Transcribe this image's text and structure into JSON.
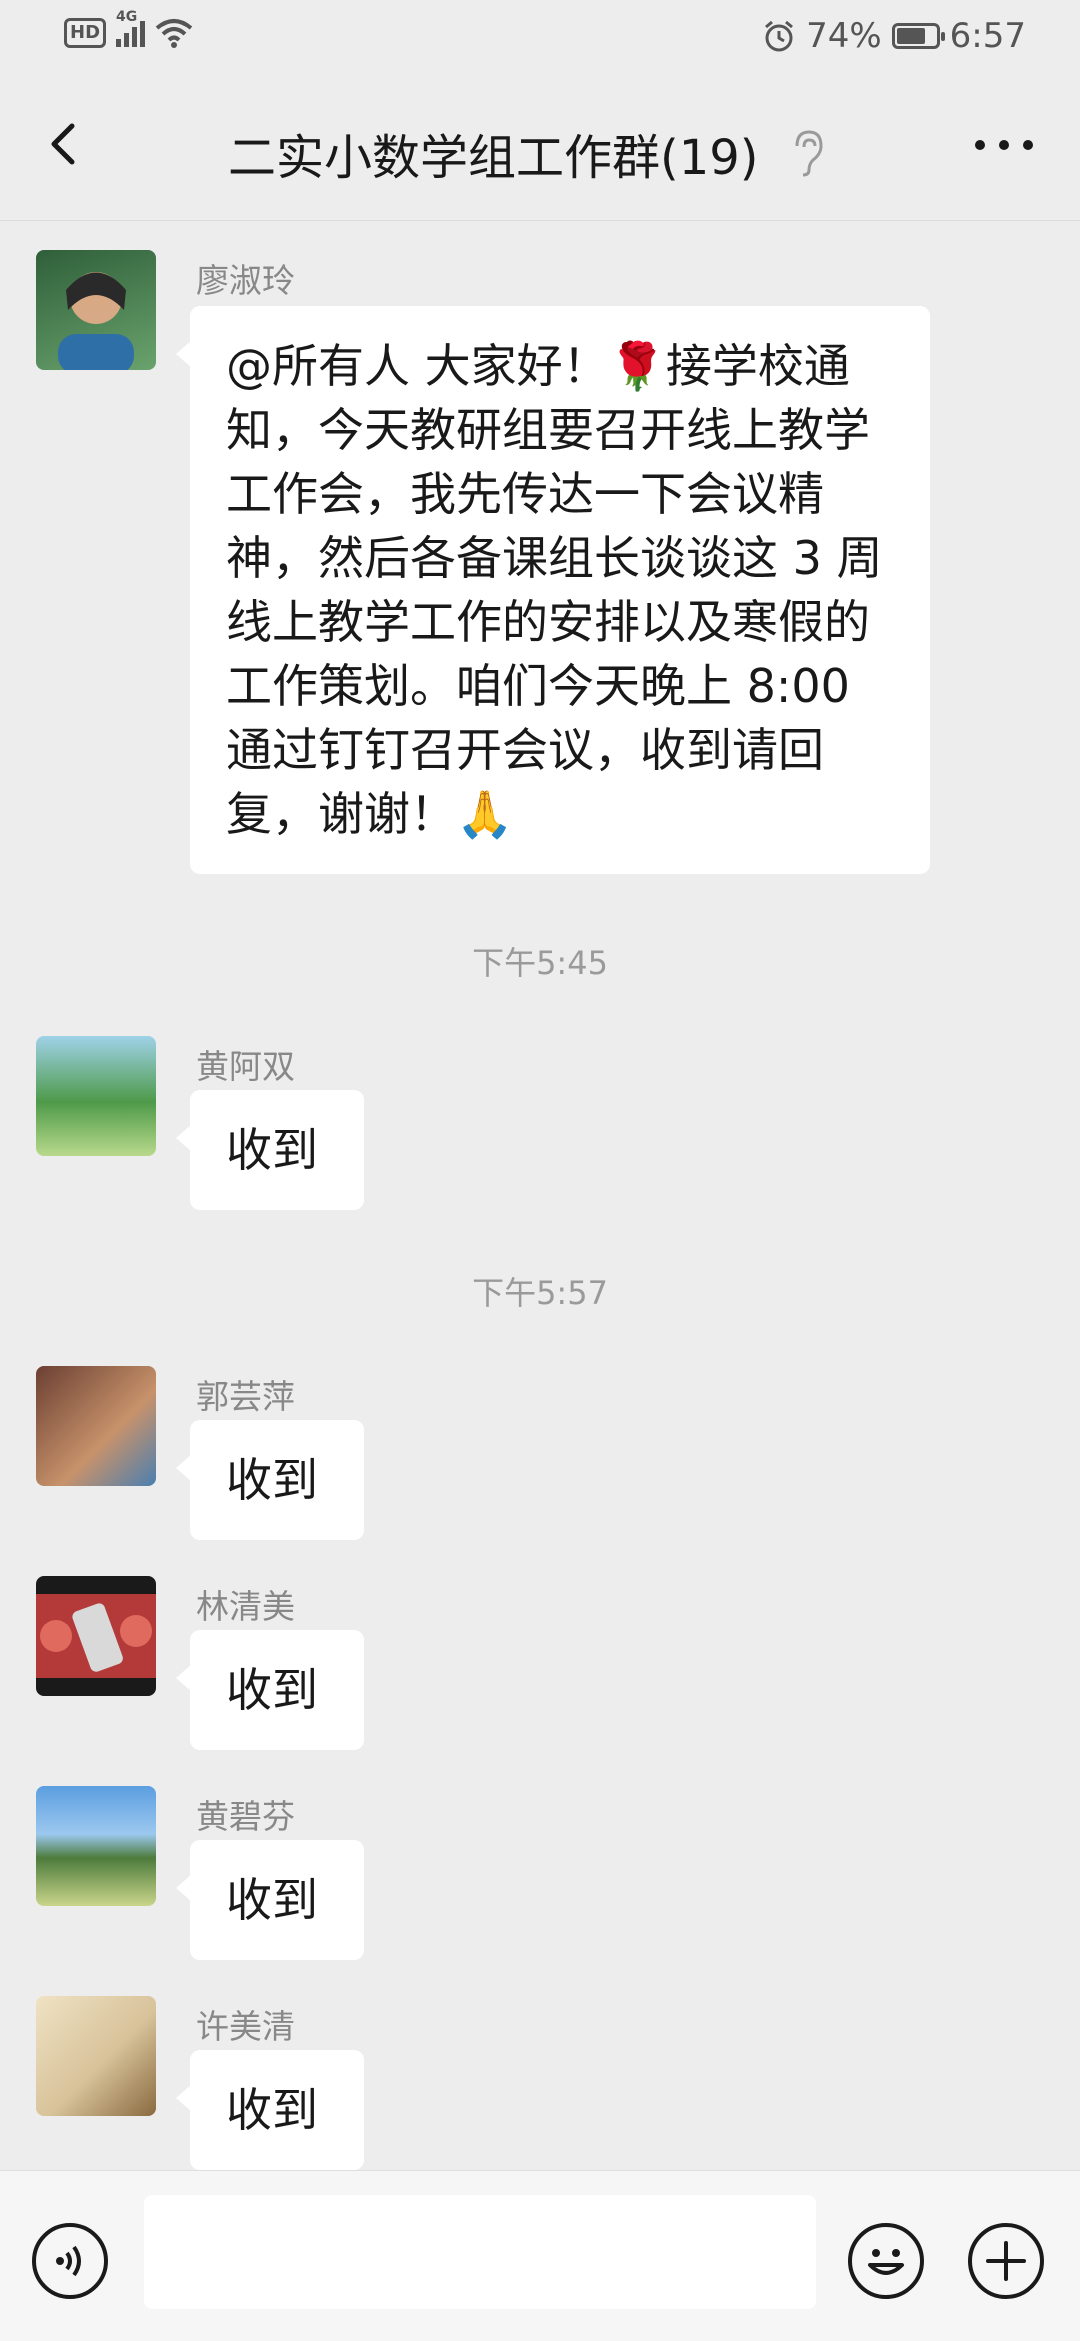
{
  "status_bar": {
    "network": "4G",
    "hd": "HD",
    "battery_text": "74%",
    "battery_level": 0.74,
    "time": "6:57"
  },
  "header": {
    "title": "二实小数学组工作群(19)",
    "back_icon": "chevron-left-icon",
    "mute_icon": "ear-icon",
    "more_icon": "more-icon"
  },
  "messages": [
    {
      "sender": "廖淑玲",
      "text": "@所有人 大家好！🌹接学校通知，今天教研组要召开线上教学工作会，我先传达一下会议精神，然后各备课组长谈谈这 3 周线上教学工作的安排以及寒假的工作策划。咱们今天晚上 8:00 通过钉钉召开会议，收到请回复，谢谢！🙏",
      "avatar_colors": [
        "#2f5f3a",
        "#6aa36d"
      ]
    },
    {
      "time": "下午5:45"
    },
    {
      "sender": "黄阿双",
      "text": "收到",
      "avatar_colors": [
        "#3e8f3e",
        "#b9d98b"
      ]
    },
    {
      "time": "下午5:57"
    },
    {
      "sender": "郭芸萍",
      "text": "收到",
      "avatar_colors": [
        "#6b3f32",
        "#c7926b"
      ]
    },
    {
      "sender": "林清美",
      "text": "收到",
      "avatar_colors": [
        "#1a1a1a",
        "#c0302e"
      ]
    },
    {
      "sender": "黄碧芬",
      "text": "收到",
      "avatar_colors": [
        "#3f7fc7",
        "#9cc26a"
      ]
    },
    {
      "sender": "许美清",
      "text": "收到",
      "avatar_colors": [
        "#d8c39a",
        "#8a6a40"
      ]
    }
  ],
  "input_bar": {
    "voice_icon": "voice-icon",
    "emoji_icon": "emoji-icon",
    "plus_icon": "plus-icon"
  }
}
